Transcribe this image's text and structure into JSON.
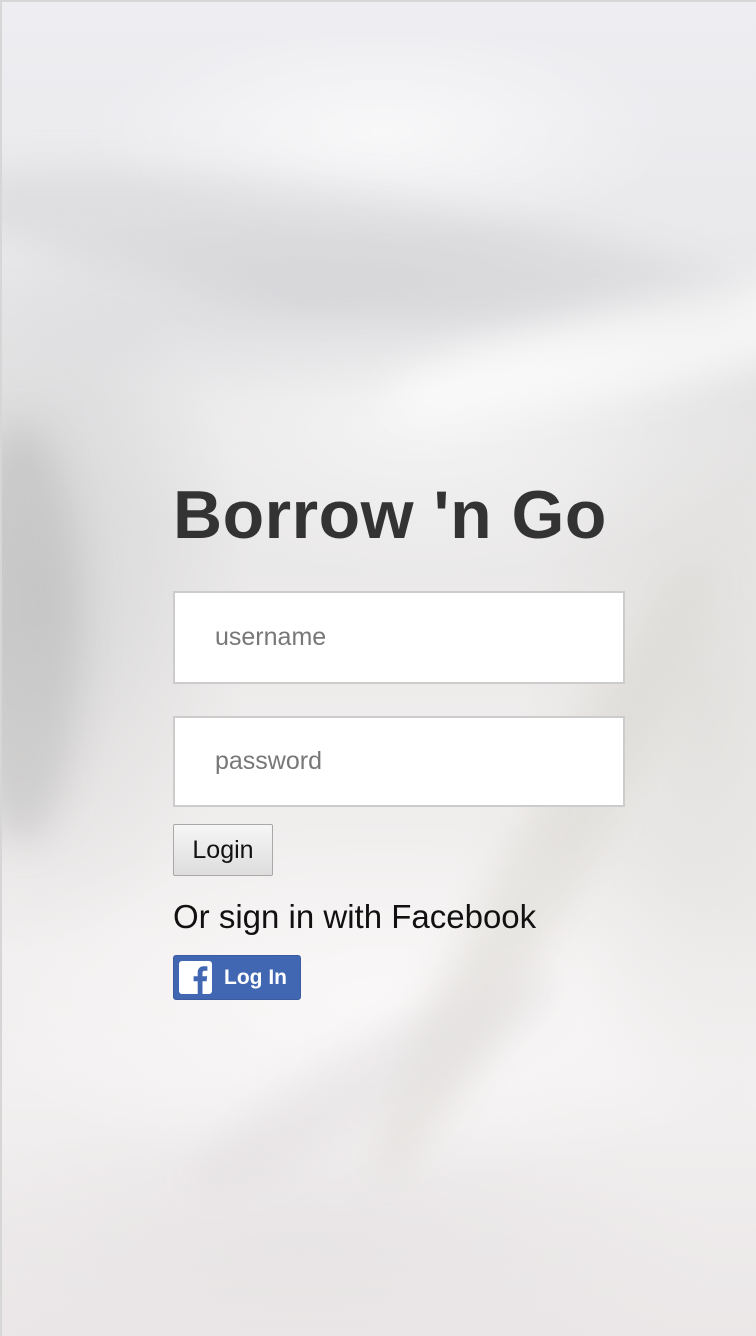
{
  "login": {
    "app_title": "Borrow 'n Go",
    "username_placeholder": "username",
    "password_placeholder": "password",
    "login_button_label": "Login",
    "facebook_prompt": "Or sign in with Facebook",
    "facebook_button_label": "Log In",
    "facebook_icon": "facebook-f-icon"
  },
  "colors": {
    "facebook_blue": "#4267b2",
    "title_text": "#333333",
    "field_border": "#cccccc",
    "placeholder_text": "#777777"
  }
}
